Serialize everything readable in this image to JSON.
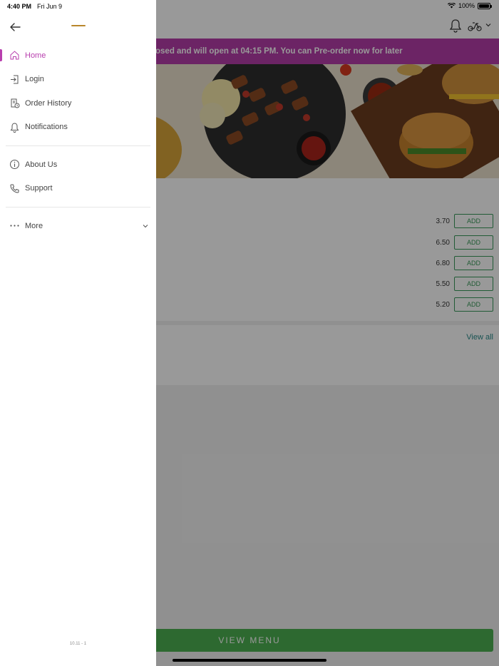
{
  "status_bar": {
    "time": "4:40 PM",
    "date": "Fri Jun 9",
    "battery": "100%"
  },
  "banner": {
    "text": "osed and will open at 04:15 PM. You can Pre-order now for later"
  },
  "items": [
    {
      "price": "3.70",
      "add_label": "ADD"
    },
    {
      "price": "6.50",
      "add_label": "ADD"
    },
    {
      "price": "6.80",
      "add_label": "ADD"
    },
    {
      "price": "5.50",
      "add_label": "ADD"
    },
    {
      "price": "5.20",
      "add_label": "ADD"
    }
  ],
  "view_all": "View all",
  "view_menu": "VIEW MENU",
  "drawer": {
    "nav": [
      {
        "label": "Home",
        "icon": "home-icon",
        "active": true
      },
      {
        "label": "Login",
        "icon": "login-icon"
      },
      {
        "label": "Order History",
        "icon": "order-history-icon"
      },
      {
        "label": "Notifications",
        "icon": "bell-icon"
      }
    ],
    "nav2": [
      {
        "label": "About Us",
        "icon": "info-icon"
      },
      {
        "label": "Support",
        "icon": "phone-icon"
      }
    ],
    "more": "More",
    "version": "10.11 - 1"
  },
  "colors": {
    "accent": "#b83fae",
    "banner": "#b53ca8",
    "add_green": "#3a9a5a",
    "view_menu_green": "#4caf50"
  }
}
